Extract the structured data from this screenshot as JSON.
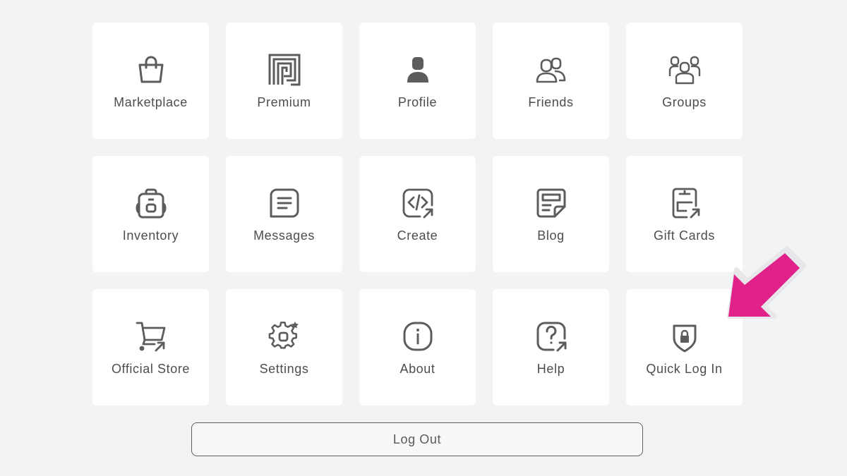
{
  "tiles": [
    {
      "label": "Marketplace",
      "icon": "shopping-bag-icon"
    },
    {
      "label": "Premium",
      "icon": "premium-icon"
    },
    {
      "label": "Profile",
      "icon": "profile-icon"
    },
    {
      "label": "Friends",
      "icon": "friends-icon"
    },
    {
      "label": "Groups",
      "icon": "groups-icon"
    },
    {
      "label": "Inventory",
      "icon": "backpack-icon"
    },
    {
      "label": "Messages",
      "icon": "message-icon"
    },
    {
      "label": "Create",
      "icon": "create-code-icon"
    },
    {
      "label": "Blog",
      "icon": "blog-icon"
    },
    {
      "label": "Gift Cards",
      "icon": "gift-card-icon"
    },
    {
      "label": "Official Store",
      "icon": "shopping-cart-icon"
    },
    {
      "label": "Settings",
      "icon": "gear-icon"
    },
    {
      "label": "About",
      "icon": "info-icon"
    },
    {
      "label": "Help",
      "icon": "help-icon"
    },
    {
      "label": "Quick Log In",
      "icon": "shield-lock-icon"
    }
  ],
  "logout_label": "Log Out",
  "colors": {
    "background": "#f2f3f5",
    "tile": "#ffffff",
    "icon": "#5b5c5e",
    "arrow": "#e0218a"
  }
}
